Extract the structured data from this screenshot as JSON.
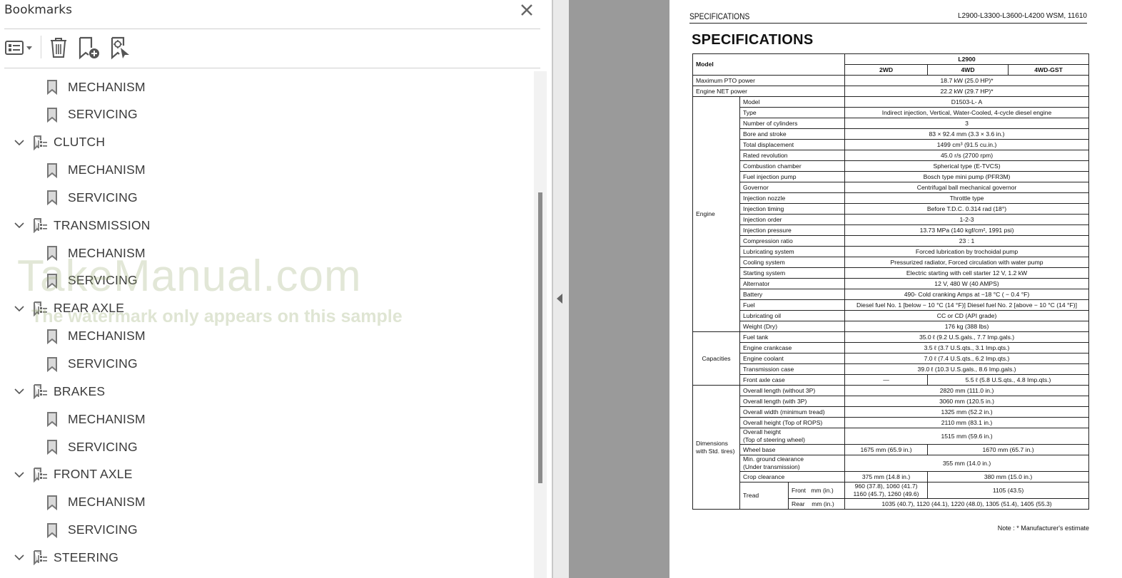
{
  "bookmarks_panel": {
    "title": "Bookmarks",
    "close_icon": "close-icon",
    "toolbar": {
      "options": "options-menu-icon",
      "delete": "delete-bookmark-icon",
      "new": "new-bookmark-icon",
      "find": "find-current-bookmark-icon"
    },
    "items": [
      {
        "type": "leaf",
        "label": "MECHANISM"
      },
      {
        "type": "leaf",
        "label": "SERVICING"
      },
      {
        "type": "parent",
        "label": "CLUTCH",
        "expanded": true
      },
      {
        "type": "leaf",
        "label": "MECHANISM"
      },
      {
        "type": "leaf",
        "label": "SERVICING"
      },
      {
        "type": "parent",
        "label": "TRANSMISSION",
        "expanded": true
      },
      {
        "type": "leaf",
        "label": "MECHANISM"
      },
      {
        "type": "leaf",
        "label": "SERVICING"
      },
      {
        "type": "parent",
        "label": "REAR AXLE",
        "expanded": true
      },
      {
        "type": "leaf",
        "label": "MECHANISM"
      },
      {
        "type": "leaf",
        "label": "SERVICING"
      },
      {
        "type": "parent",
        "label": "BRAKES",
        "expanded": true
      },
      {
        "type": "leaf",
        "label": "MECHANISM"
      },
      {
        "type": "leaf",
        "label": "SERVICING"
      },
      {
        "type": "parent",
        "label": "FRONT AXLE",
        "expanded": true
      },
      {
        "type": "leaf",
        "label": "MECHANISM"
      },
      {
        "type": "leaf",
        "label": "SERVICING"
      },
      {
        "type": "parent",
        "label": "STEERING",
        "expanded": true
      }
    ]
  },
  "watermark": {
    "main": "TakeManual.com",
    "sub": "The watermark only appears on this sample"
  },
  "document": {
    "header_left": "SPECIFICATIONS",
    "header_right": "L2900-L3300-L3600-L4200  WSM, 11610",
    "title": "SPECIFICATIONS",
    "table": {
      "model_label": "Model",
      "model_name": "L2900",
      "variants": [
        "2WD",
        "4WD",
        "4WD-GST"
      ],
      "max_pto": {
        "label": "Maximum PTO power",
        "value": "18.7 kW (25.0 HP)*"
      },
      "net_power": {
        "label": "Engine NET power",
        "value": "22.2 kW (29.7 HP)*"
      },
      "engine": {
        "group": "Engine",
        "rows": [
          {
            "label": "Model",
            "value": "D1503-L- A"
          },
          {
            "label": "Type",
            "value": "Indirect injection, Vertical, Water-Cooled, 4-cycle diesel engine"
          },
          {
            "label": "Number of cylinders",
            "value": "3"
          },
          {
            "label": "Bore and stroke",
            "value": "83 × 92.4 mm (3.3 × 3.6 in.)"
          },
          {
            "label": "Total displacement",
            "value": "1499 cm³ (91.5 cu.in.)"
          },
          {
            "label": "Rated revolution",
            "value": "45.0 r/s (2700 rpm)"
          },
          {
            "label": "Combustion chamber",
            "value": "Spherical type (E-TVCS)"
          },
          {
            "label": "Fuel injection pump",
            "value": "Bosch type mini pump (PFR3M)"
          },
          {
            "label": "Governor",
            "value": "Centrifugal ball mechanical governor"
          },
          {
            "label": "Injection nozzle",
            "value": "Throttle type"
          },
          {
            "label": "Injection timing",
            "value": "Before T.D.C. 0.314 rad (18°)"
          },
          {
            "label": "Injection order",
            "value": "1-2-3"
          },
          {
            "label": "Injection pressure",
            "value": "13.73 MPa (140 kgf/cm², 1991 psi)"
          },
          {
            "label": "Compression ratio",
            "value": "23 : 1"
          },
          {
            "label": "Lubricating system",
            "value": "Forced lubrication by trochoidal pump"
          },
          {
            "label": "Cooling system",
            "value": "Pressurized radiator, Forced circulation with water pump"
          },
          {
            "label": "Starting system",
            "value": "Electric starting with cell starter 12 V, 1.2 kW"
          },
          {
            "label": "Alternator",
            "value": "12 V, 480 W (40 AMPS)"
          },
          {
            "label": "Battery",
            "value": "490- Cold cranking Amps at −18 °C ( − 0.4 °F)"
          },
          {
            "label": "Fuel",
            "value": "Diesel fuel No. 1 [below − 10 °C (14 °F)] Diesel fuel No. 2 [above − 10 °C (14 °F)]"
          },
          {
            "label": "Lubricating oil",
            "value": "CC or CD (API grade)"
          },
          {
            "label": "Weight (Dry)",
            "value": "176 kg (388 lbs)"
          }
        ]
      },
      "capacities": {
        "group": "Capacities",
        "rows": [
          {
            "label": "Fuel tank",
            "value": "35.0 ℓ (9.2 U.S.gals., 7.7 Imp.gals.)"
          },
          {
            "label": "Engine crankcase",
            "value": "3.5 ℓ (3.7 U.S.qts., 3.1 Imp.qts.)"
          },
          {
            "label": "Engine coolant",
            "value": "7.0 ℓ (7.4 U.S.qts., 6.2 Imp.qts.)"
          },
          {
            "label": "Transmission case",
            "value": "39.0 ℓ (10.3 U.S.gals., 8.6 Imp.gals.)"
          }
        ],
        "front_axle": {
          "label": "Front axle case",
          "value_2wd": "—",
          "value_4wd": "5.5 ℓ (5.8 U.S.qts., 4.8 Imp.qts.)"
        }
      },
      "dimensions": {
        "group": "Dimensions with Std. tires)",
        "rows": [
          {
            "label": "Overall length (without 3P)",
            "value": "2820 mm (111.0 in.)"
          },
          {
            "label": "Overall length (with 3P)",
            "value": "3060 mm (120.5 in.)"
          },
          {
            "label": "Overall width (minimum tread)",
            "value": "1325 mm (52.2 in.)"
          },
          {
            "label": "Overall height (Top of ROPS)",
            "value": "2110 mm (83.1 in.)"
          }
        ],
        "height_wheel": {
          "label1": "Overall height",
          "label2": "(Top of steering wheel)",
          "value": "1515 mm (59.6 in.)"
        },
        "wheel_base": {
          "label": "Wheel base",
          "value_2wd": "1675 mm (65.9 in.)",
          "value_4wd": "1670 mm (65.7 in.)"
        },
        "ground_clearance": {
          "label1": "Min. ground clearance",
          "label2": "(Under transmission)",
          "value": "355 mm (14.0 in.)"
        },
        "crop_clearance": {
          "label": "Crop clearance",
          "value_2wd": "375 mm (14.8 in.)",
          "value_4wd": "380 mm (15.0 in.)"
        },
        "tread": {
          "label": "Tread",
          "front_label": "Front",
          "rear_label": "Rear",
          "unit": "mm (in.)",
          "front_2wd_line1": "960 (37.8), 1060 (41.7)",
          "front_2wd_line2": "1160 (45.7), 1260 (49.6)",
          "front_4wd": "1105 (43.5)",
          "rear": "1035 (40.7), 1120 (44.1), 1220 (48.0), 1305 (51.4), 1405 (55.3)"
        }
      }
    },
    "note": "Note : * Manufacturer's estimate"
  }
}
